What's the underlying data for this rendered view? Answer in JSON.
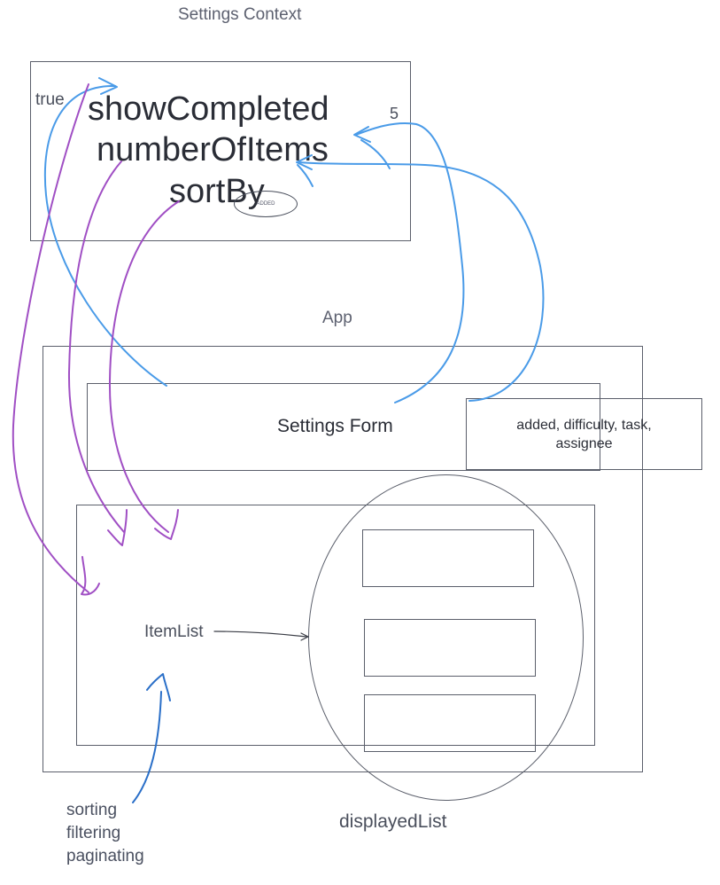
{
  "settings_context": {
    "title": "Settings Context",
    "fields": {
      "show_completed": "showCompleted",
      "number_of_items": "numberOfItems",
      "sort_by": "sortBy"
    },
    "show_completed_value": "true",
    "number_of_items_value": "5",
    "sort_by_value": "ADDED"
  },
  "app": {
    "title": "App",
    "settings_form": "Settings Form",
    "sort_options": "added, difficulty, task, assignee",
    "item_list": "ItemList",
    "displayed_list": "displayedList",
    "notes": {
      "sorting": "sorting",
      "filtering": "filtering",
      "paginating": "paginating"
    }
  },
  "colors": {
    "box_stroke": "#5b5f6b",
    "blue_arrow": "#4a9be8",
    "purple_arrow": "#a04fc4",
    "dark_blue_arrow": "#2a6fc8"
  }
}
